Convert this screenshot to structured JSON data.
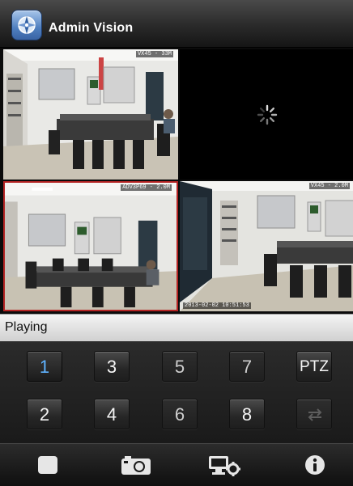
{
  "header": {
    "title": "Admin Vision",
    "logo_icon": "compass-icon"
  },
  "cameras": [
    {
      "label": "VX45 - 33M",
      "timestamp": "",
      "state": "playing",
      "selected": false
    },
    {
      "label": "",
      "timestamp": "",
      "state": "loading",
      "selected": false
    },
    {
      "label": "ADV3P69 - 2.0M",
      "timestamp": "",
      "state": "playing",
      "selected": true
    },
    {
      "label": "VX45 - 2.0M",
      "timestamp": "2013-02-02 10:51:53",
      "state": "playing",
      "selected": false
    }
  ],
  "status": {
    "text": "Playing"
  },
  "channels": {
    "row1": [
      "1",
      "3",
      "5",
      "7",
      "PTZ"
    ],
    "row2": [
      "2",
      "4",
      "6",
      "8"
    ],
    "active": "1",
    "swap_icon": "swap-arrows-icon"
  },
  "toolbar": {
    "icons": [
      "stop-icon",
      "camera-icon",
      "device-settings-icon",
      "info-icon"
    ]
  },
  "colors": {
    "accent": "#5fb3ff",
    "selected_border": "#b42323"
  }
}
